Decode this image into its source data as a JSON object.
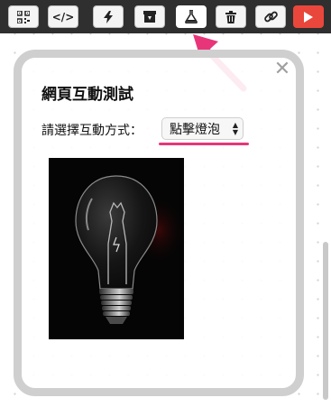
{
  "toolbar": {
    "buttons": [
      {
        "icon": "qr-code-icon",
        "label": ""
      },
      {
        "icon": "code-icon",
        "label": "</>"
      },
      {
        "icon": "lightning-icon",
        "label": ""
      },
      {
        "icon": "archive-box-icon",
        "label": ""
      },
      {
        "icon": "flask-icon",
        "label": ""
      },
      {
        "icon": "trash-icon",
        "label": ""
      },
      {
        "icon": "link-icon",
        "label": ""
      },
      {
        "icon": "play-icon",
        "label": ""
      }
    ],
    "active_button": "flask-icon"
  },
  "dialog": {
    "title": "網頁互動測試",
    "close_label": "✕",
    "prompt_label": "請選擇互動方式：",
    "select_value": "點擊燈泡"
  },
  "image": {
    "subject": "light-bulb-photo"
  },
  "colors": {
    "toolbar_bg": "#2f2f2f",
    "play_button": "#e9473b",
    "annotation_pink": "#e8357a",
    "card_border": "#cfcfcf"
  }
}
